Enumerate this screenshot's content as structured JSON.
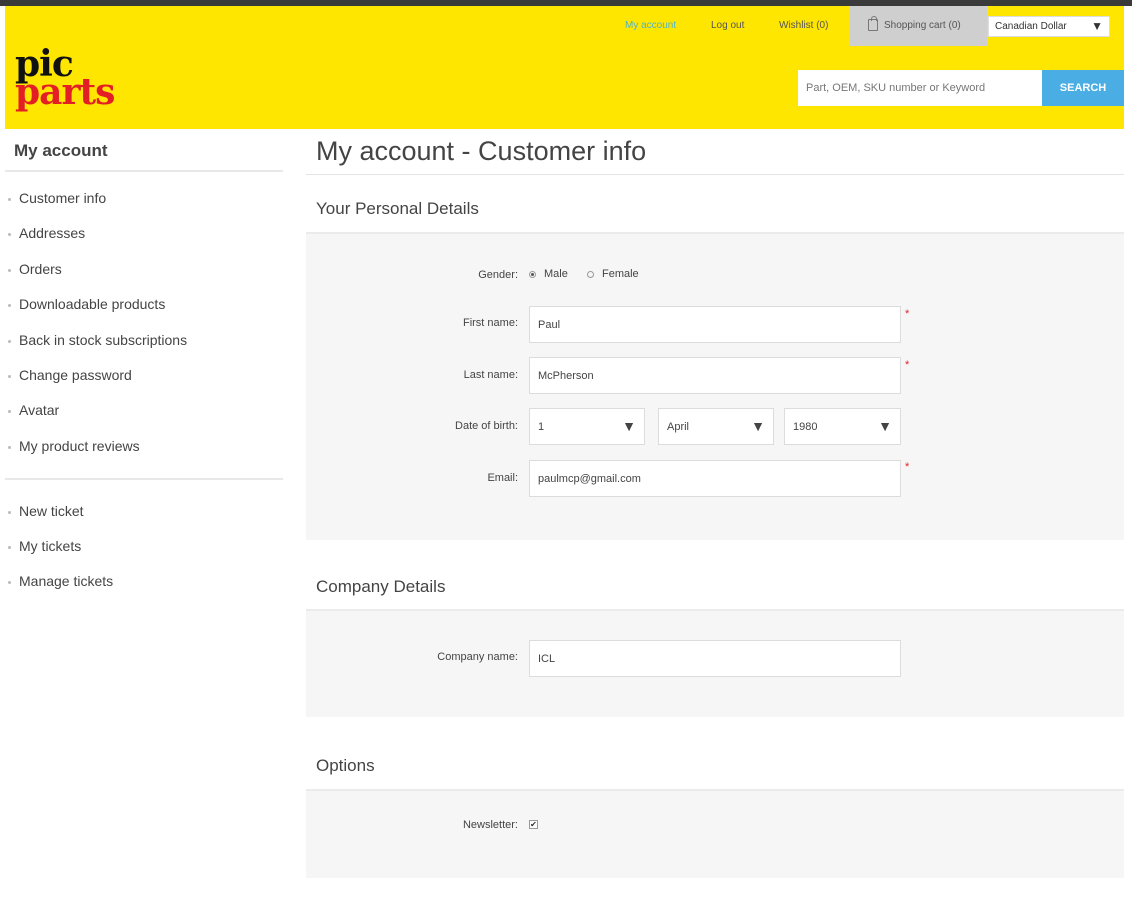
{
  "header": {
    "links": {
      "my_account": "My account",
      "logout": "Log out",
      "wishlist": "Wishlist (0)",
      "cart": "Shopping cart (0)"
    },
    "currency": "Canadian Dollar",
    "logo": {
      "line1": "pic",
      "line2": "parts"
    },
    "search": {
      "placeholder": "Part, OEM, SKU number or Keyword",
      "button": "SEARCH"
    }
  },
  "sidebar": {
    "title": "My account",
    "items": [
      "Customer info",
      "Addresses",
      "Orders",
      "Downloadable products",
      "Back in stock subscriptions",
      "Change password",
      "Avatar",
      "My product reviews"
    ],
    "ticket_items": [
      "New ticket",
      "My tickets",
      "Manage tickets"
    ]
  },
  "main": {
    "title": "My account - Customer info",
    "personal": {
      "title": "Your Personal Details",
      "gender_label": "Gender:",
      "male": "Male",
      "female": "Female",
      "first_name_label": "First name:",
      "first_name": "Paul",
      "last_name_label": "Last name:",
      "last_name": "McPherson",
      "dob_label": "Date of birth:",
      "dob_day": "1",
      "dob_month": "April",
      "dob_year": "1980",
      "email_label": "Email:",
      "email": "paulmcp@gmail.com",
      "required_mark": "*"
    },
    "company": {
      "title": "Company Details",
      "name_label": "Company name:",
      "name": "ICL"
    },
    "options": {
      "title": "Options",
      "newsletter_label": "Newsletter:",
      "newsletter_checked": "✔"
    }
  },
  "colors": {
    "header_bg": "#ffe600",
    "search_button": "#4aaee4",
    "logo_red": "#e31e24"
  }
}
